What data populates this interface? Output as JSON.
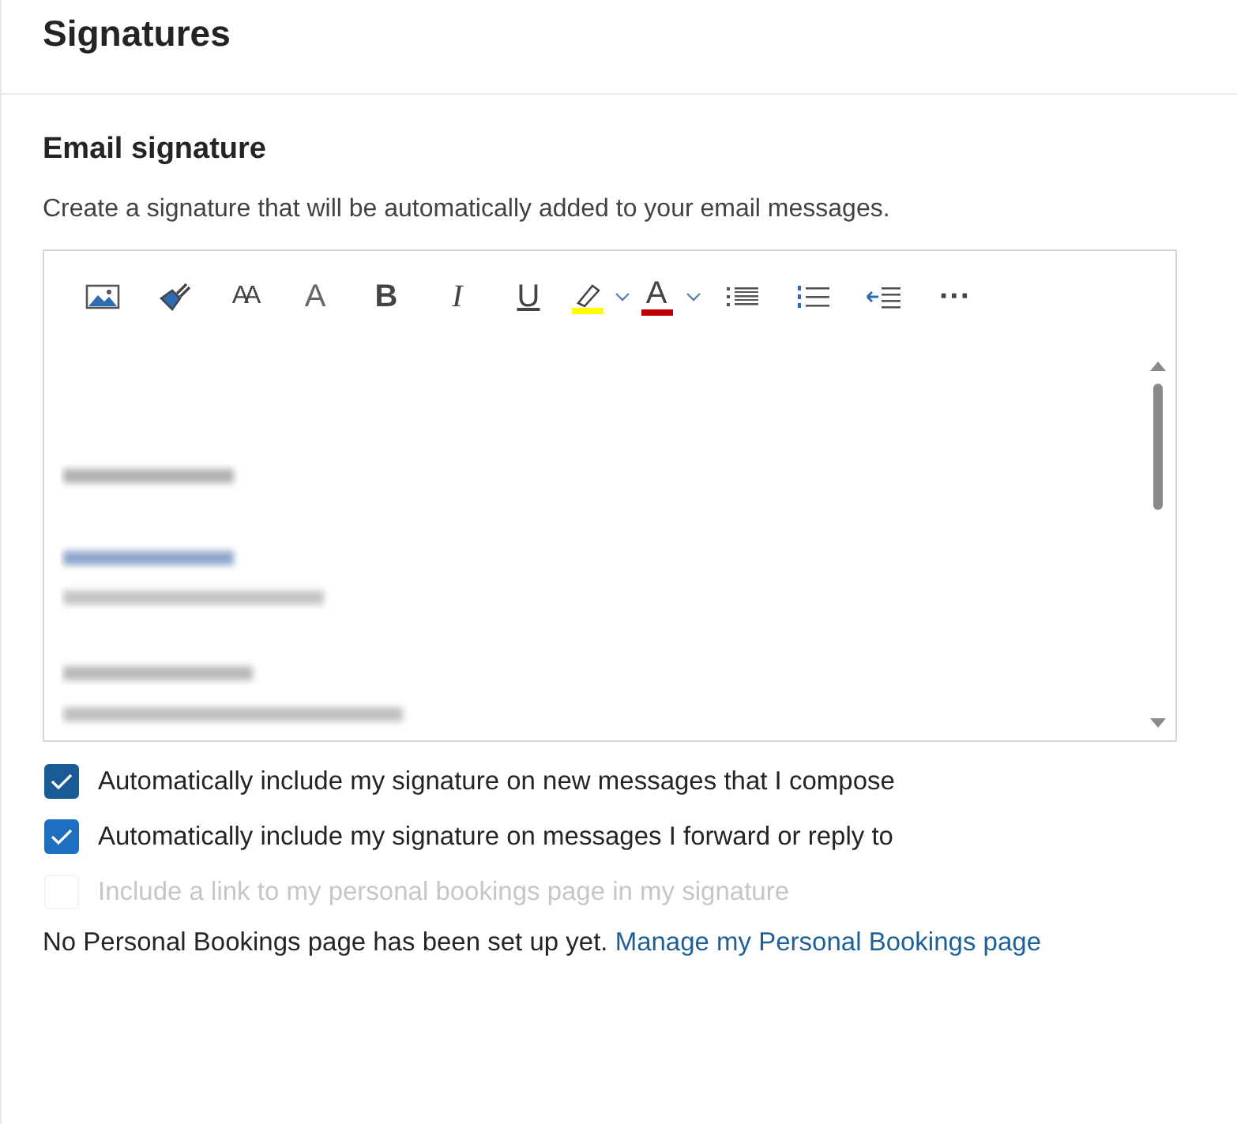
{
  "header": {
    "title": "Signatures"
  },
  "section": {
    "title": "Email signature",
    "description": "Create a signature that will be automatically added to your email messages."
  },
  "toolbar": [
    {
      "kind": "image"
    },
    {
      "kind": "brush"
    },
    {
      "kind": "size",
      "label": "AA"
    },
    {
      "kind": "grow",
      "label": "A"
    },
    {
      "kind": "bold",
      "label": "B"
    },
    {
      "kind": "italic",
      "label": "I"
    },
    {
      "kind": "underline",
      "label": "U"
    },
    {
      "kind": "highlight",
      "color": "#ffff00"
    },
    {
      "kind": "fontcolor",
      "label": "A",
      "color": "#c00000"
    },
    {
      "kind": "bullets"
    },
    {
      "kind": "numbers"
    },
    {
      "kind": "outdent"
    },
    {
      "kind": "more",
      "label": "···"
    }
  ],
  "options": [
    {
      "label": "Automatically include my signature on new messages that I compose",
      "checked": true,
      "disabled": false
    },
    {
      "label": "Automatically include my signature on messages I forward or reply to",
      "checked": true,
      "disabled": false
    },
    {
      "label": "Include a link to my personal bookings page in my signature",
      "checked": false,
      "disabled": true
    }
  ],
  "footer": {
    "text": "No Personal Bookings page has been set up yet.",
    "link": "Manage my Personal Bookings page"
  }
}
